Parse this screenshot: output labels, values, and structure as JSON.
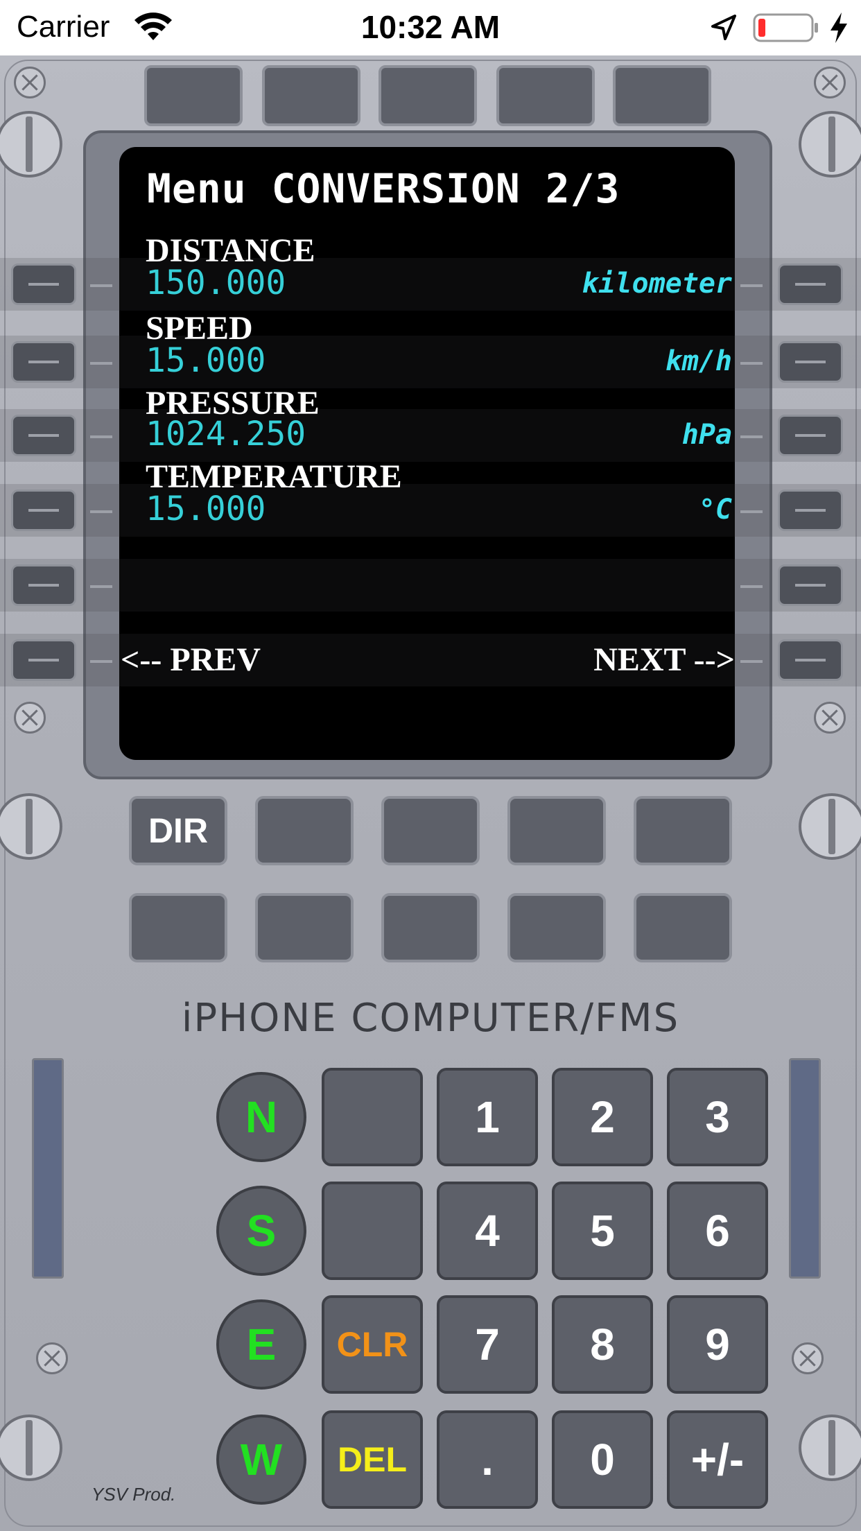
{
  "status_bar": {
    "carrier": "Carrier",
    "time": "10:32 AM",
    "icons": [
      "wifi-icon",
      "location-arrow-icon",
      "battery-low-icon",
      "charging-bolt-icon"
    ]
  },
  "screen": {
    "title": "Menu CONVERSION 2/3",
    "rows": [
      {
        "label": "DISTANCE",
        "value": "150.000",
        "unit": "kilometer"
      },
      {
        "label": "SPEED",
        "value": "15.000",
        "unit": "km/h"
      },
      {
        "label": "PRESSURE",
        "value": "1024.250",
        "unit": "hPa"
      },
      {
        "label": "TEMPERATURE",
        "value": "15.000",
        "unit": "°C"
      }
    ],
    "prev": "<-- PREV",
    "next": "NEXT -->"
  },
  "function_keys": {
    "dir": "DIR"
  },
  "brand": "iPHONE COMPUTER/FMS",
  "keypad": {
    "compass": [
      "N",
      "S",
      "E",
      "W"
    ],
    "clr": "CLR",
    "del": "DEL",
    "digits": [
      "1",
      "2",
      "3",
      "4",
      "5",
      "6",
      "7",
      "8",
      "9",
      ".",
      "0",
      "+/-"
    ]
  },
  "credit": "YSV Prod.",
  "colors": {
    "screen_bg": "#000000",
    "value_cyan": "#36d0d8",
    "unit_cyan": "#3fe0ee",
    "compass_green": "#22e021",
    "clr_orange": "#f29218",
    "del_yellow": "#f5ee1a",
    "panel_gray": "#b0b2ba"
  }
}
